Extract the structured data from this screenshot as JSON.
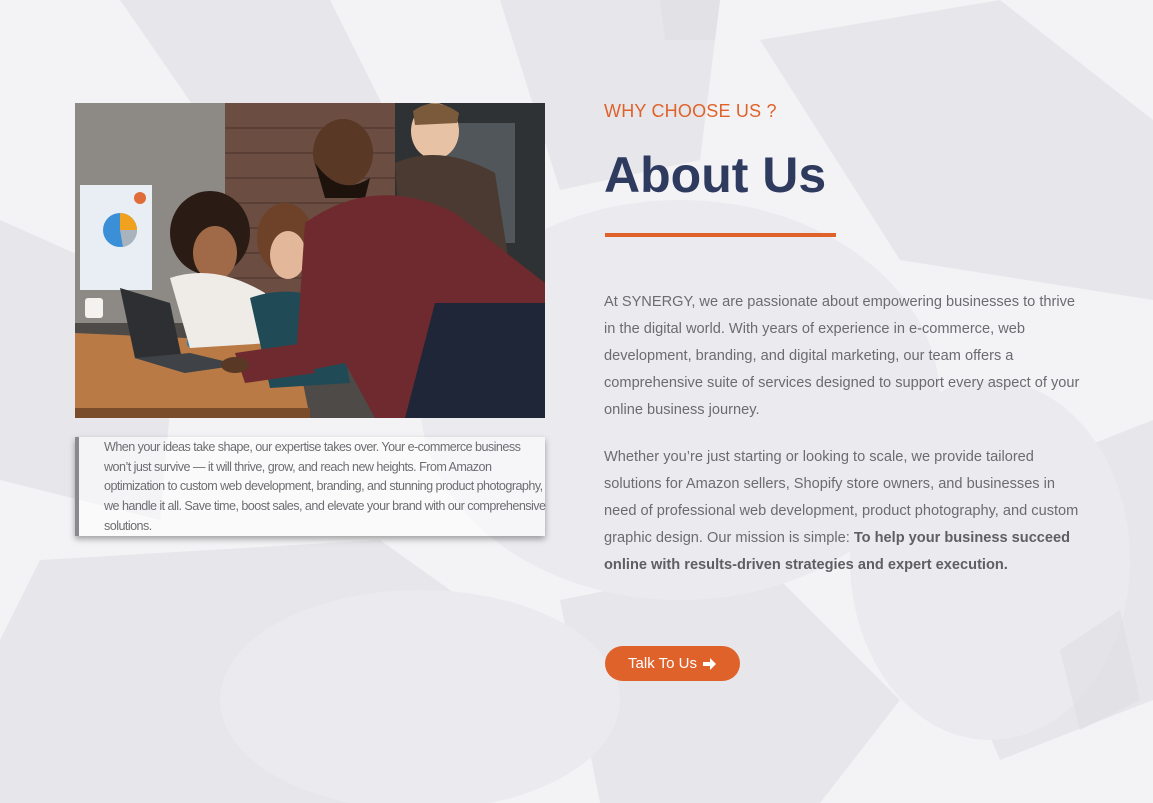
{
  "about": {
    "eyebrow": "WHY CHOOSE US ?",
    "heading": "About Us",
    "paragraph1": "At SYNERGY, we are passionate about empowering businesses to thrive in the digital world. With years of experience in e-commerce, web development, branding, and digital marketing, our team offers a comprehensive suite of services designed to support every aspect of your online business journey.",
    "paragraph2_lead": "Whether you’re just starting or looking to scale, we provide tailored solutions for Amazon sellers, Shopify store owners, and businesses in need of professional web development, product photography, and custom graphic design. Our mission is simple: ",
    "paragraph2_bold": "To help your business succeed online with results-driven strategies and expert execution.",
    "cta_label": "Talk To Us",
    "cta_icon": "arrow-right-icon"
  },
  "caption": {
    "text": "When your ideas take shape, our expertise takes over. Your e-commerce business won’t just survive — it will thrive, grow, and reach new heights. From Amazon optimization to custom web development, branding, and stunning product photography, we handle it all. Save time, boost sales, and elevate your brand with our comprehensive solutions."
  },
  "colors": {
    "accent": "#e0622b",
    "heading": "#2e3a5e",
    "body_text": "#6b6b70"
  }
}
